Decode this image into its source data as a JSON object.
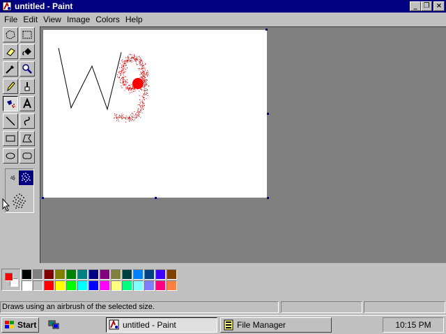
{
  "window": {
    "title": "untitled - Paint",
    "minimize_glyph": "_",
    "maximize_glyph": "❐",
    "close_glyph": "×"
  },
  "menu": [
    {
      "label": "File",
      "mnemonic": "F"
    },
    {
      "label": "Edit",
      "mnemonic": "E"
    },
    {
      "label": "View",
      "mnemonic": "V"
    },
    {
      "label": "Image",
      "mnemonic": "I"
    },
    {
      "label": "Colors",
      "mnemonic": "C"
    },
    {
      "label": "Help",
      "mnemonic": "H"
    }
  ],
  "toolbox": {
    "tools": [
      {
        "name": "free-form-select-icon"
      },
      {
        "name": "select-icon"
      },
      {
        "name": "eraser-icon"
      },
      {
        "name": "fill-bucket-icon"
      },
      {
        "name": "pick-color-icon"
      },
      {
        "name": "magnifier-icon"
      },
      {
        "name": "pencil-icon"
      },
      {
        "name": "brush-icon"
      },
      {
        "name": "airbrush-icon",
        "selected": true
      },
      {
        "name": "text-icon",
        "glyph": "A"
      },
      {
        "name": "line-icon"
      },
      {
        "name": "curve-icon"
      },
      {
        "name": "rectangle-icon"
      },
      {
        "name": "polygon-icon"
      },
      {
        "name": "ellipse-icon"
      },
      {
        "name": "rounded-rectangle-icon"
      }
    ],
    "airbrush_sizes": [
      "small",
      "medium",
      "large"
    ],
    "selected_size": "medium"
  },
  "colors": {
    "primary": "#ff0000",
    "secondary": "#ffffff",
    "palette_row1": [
      "#000000",
      "#808080",
      "#800000",
      "#808000",
      "#008000",
      "#008080",
      "#000080",
      "#800080",
      "#808040",
      "#004040",
      "#0080ff",
      "#004080",
      "#4000ff",
      "#804000"
    ],
    "palette_row2": [
      "#ffffff",
      "#c0c0c0",
      "#ff0000",
      "#ffff00",
      "#00ff00",
      "#00ffff",
      "#0000ff",
      "#ff00ff",
      "#ffff80",
      "#00ff80",
      "#80ffff",
      "#8080ff",
      "#ff0080",
      "#ff8040"
    ]
  },
  "status": {
    "message": "Draws using an airbrush of the selected size."
  },
  "taskbar": {
    "start_label": "Start",
    "tasks": [
      {
        "label": "untitled - Paint",
        "active": true,
        "icon": "paint-icon"
      },
      {
        "label": "File Manager",
        "active": false,
        "icon": "file-manager-icon"
      }
    ],
    "clock": "10:15 PM"
  }
}
